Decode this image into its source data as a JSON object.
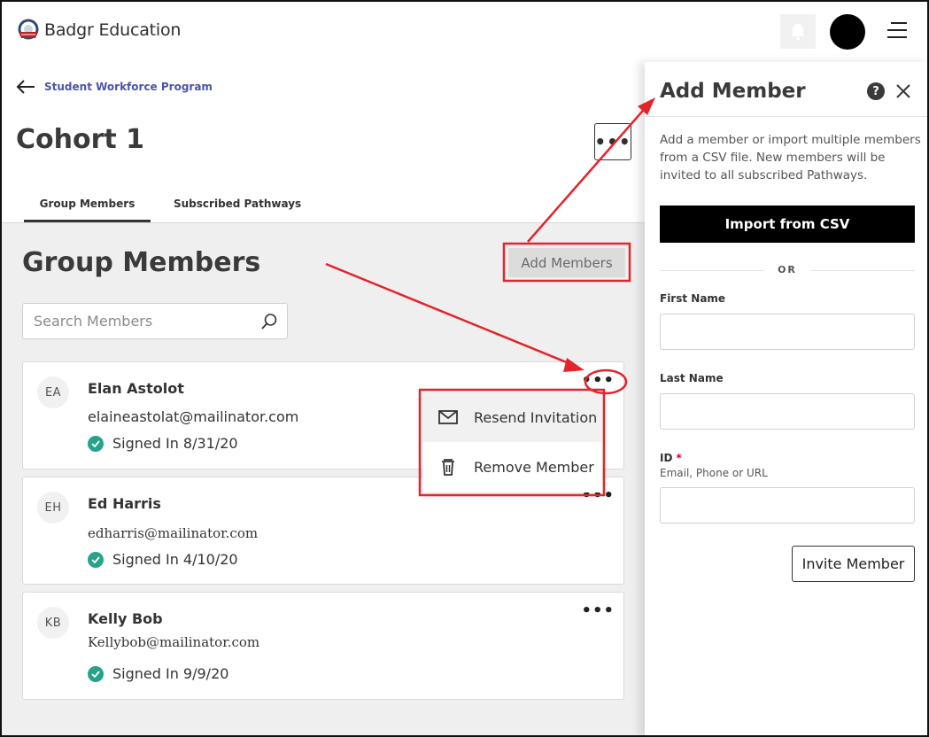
{
  "app": {
    "name": "Badgr Education"
  },
  "breadcrumb": {
    "back_label": "Student Workforce Program"
  },
  "page": {
    "title": "Cohort 1"
  },
  "tabs": [
    {
      "label": "Group Members"
    },
    {
      "label": "Subscribed Pathways"
    }
  ],
  "group": {
    "title": "Group Members",
    "add_button": "Add Members",
    "search_placeholder": "Search Members"
  },
  "members": [
    {
      "initials": "EA",
      "name": "Elan Astolot",
      "email": "elaineastolat@mailinator.com",
      "status": "Signed In 8/31/20"
    },
    {
      "initials": "EH",
      "name": "Ed Harris",
      "email": "edharris@mailinator.com",
      "status": "Signed In 4/10/20"
    },
    {
      "initials": "KB",
      "name": "Kelly Bob",
      "email": "Kellybob@mailinator.com",
      "status": "Signed In 9/9/20"
    }
  ],
  "member_menu": [
    {
      "label": "Resend Invitation",
      "icon": "envelope-icon"
    },
    {
      "label": "Remove Member",
      "icon": "trash-icon"
    }
  ],
  "drawer": {
    "title": "Add Member",
    "description": "Add a member or import multiple members from a CSV file. New members will be invited to all subscribed Pathways.",
    "import_button": "Import from CSV",
    "or_label": "OR",
    "first_name_label": "First Name",
    "last_name_label": "Last Name",
    "id_label": "ID",
    "id_required_mark": "*",
    "id_hint": "Email, Phone or URL",
    "invite_button": "Invite Member"
  },
  "colors": {
    "accent_link": "#4a56a6",
    "status_check": "#26a38a",
    "annotation": "#e3242b"
  }
}
